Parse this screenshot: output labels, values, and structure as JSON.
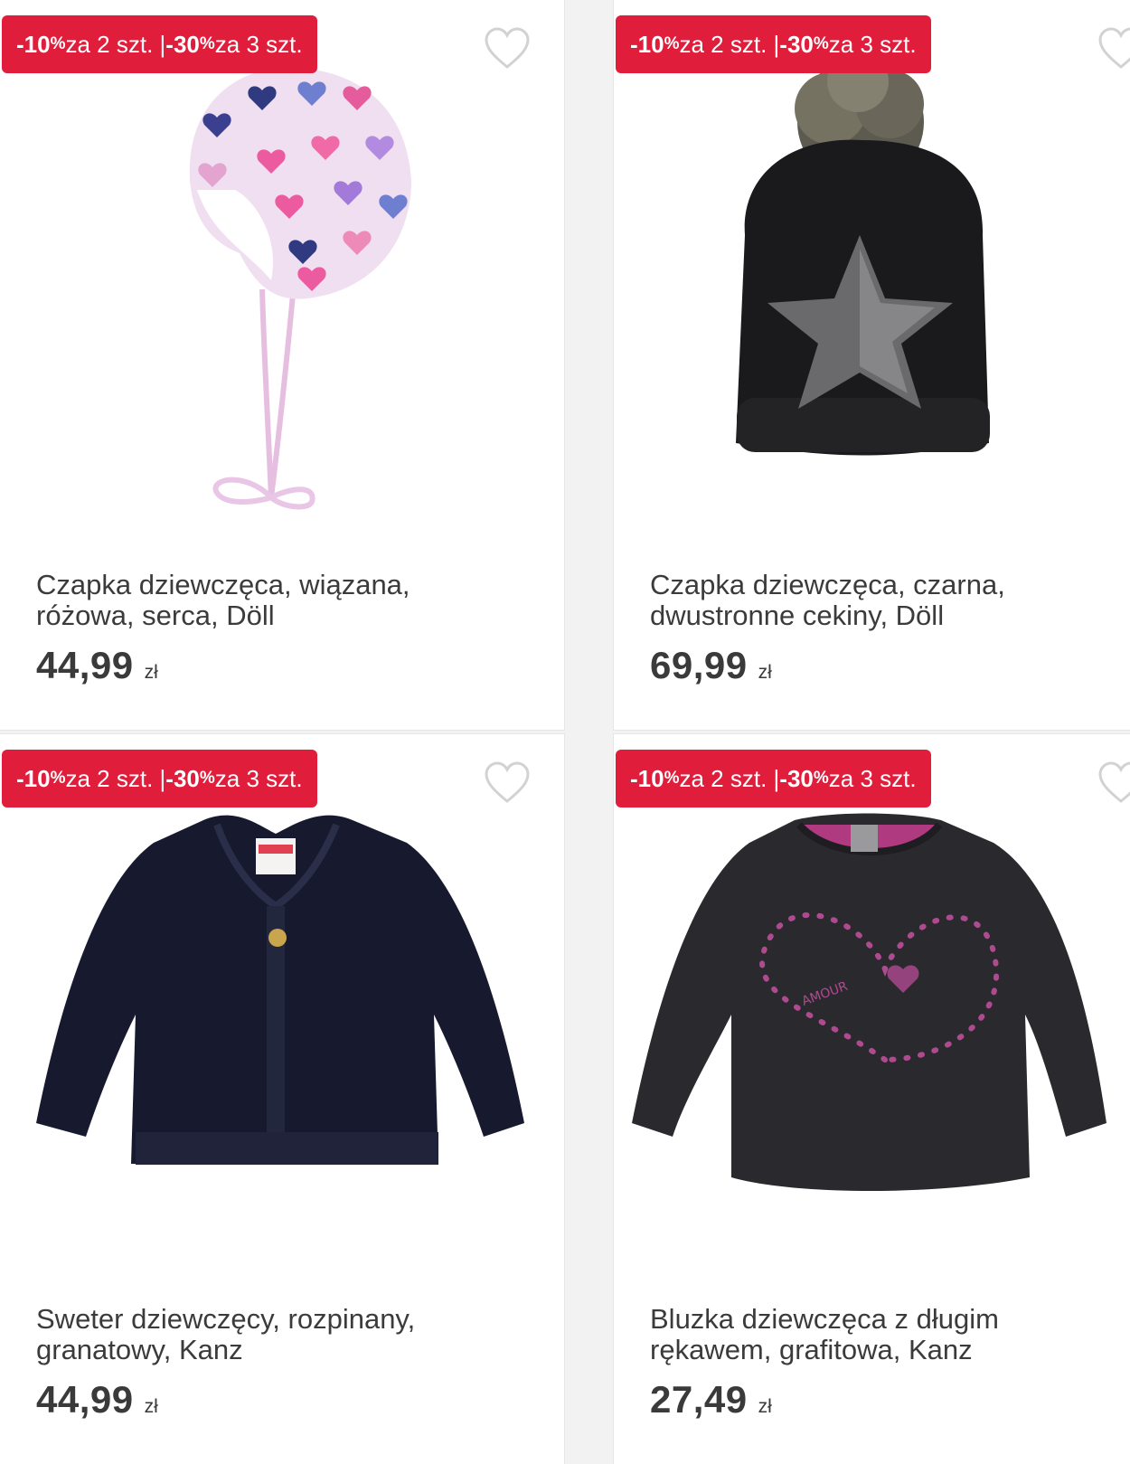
{
  "products": [
    {
      "promo": {
        "first": "-10",
        "pct": "%",
        "first_text": " za 2 szt. | ",
        "second": "-30",
        "pct2": "%",
        "second_text": " za 3 szt."
      },
      "title_line1": "Czapka dziewczęca, wiązana,",
      "title_line2": "różowa, serca, Döll",
      "price": "44,99",
      "currency": "zł",
      "image": "girls-knit-hat-pink-hearts"
    },
    {
      "promo": {
        "first": "-10",
        "pct": "%",
        "first_text": " za 2 szt. | ",
        "second": "-30",
        "pct2": "%",
        "second_text": " za 3 szt."
      },
      "title_line1": "Czapka dziewczęca, czarna,",
      "title_line2": "dwustronne cekiny, Döll",
      "price": "69,99",
      "currency": "zł",
      "image": "black-beanie-pompom-sequin-star"
    },
    {
      "promo": {
        "first": "-10",
        "pct": "%",
        "first_text": " za 2 szt. | ",
        "second": "-30",
        "pct2": "%",
        "second_text": " za 3 szt."
      },
      "title_line1": "Sweter dziewczęcy, rozpinany,",
      "title_line2": "granatowy, Kanz",
      "price": "44,99",
      "currency": "zł",
      "image": "navy-cardigan"
    },
    {
      "promo": {
        "first": "-10",
        "pct": "%",
        "first_text": " za 2 szt. | ",
        "second": "-30",
        "pct2": "%",
        "second_text": " za 3 szt."
      },
      "title_line1": "Bluzka dziewczęca z długim",
      "title_line2": "rękawem, grafitowa, Kanz",
      "price": "27,49",
      "currency": "zł",
      "image": "graphite-long-sleeve-heart"
    }
  ],
  "colors": {
    "promo": "#e01e3c",
    "text": "#3b3b3b",
    "heart_outline": "#d2d2d2"
  },
  "icons": {
    "favorite": "heart-outline-icon"
  }
}
